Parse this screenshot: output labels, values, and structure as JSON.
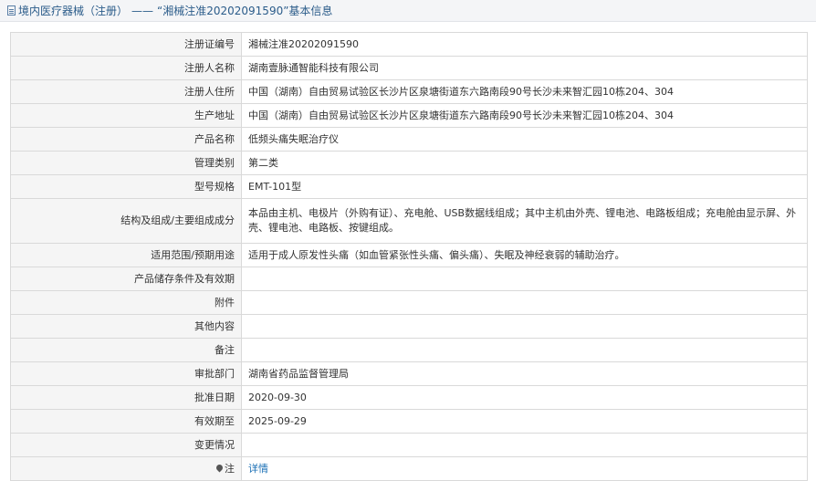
{
  "header": {
    "section": "境内医疗器械（注册）",
    "separator": "——",
    "title": "“湘械注准20202091590”基本信息"
  },
  "rows": [
    {
      "label": "注册证编号",
      "value": "湘械注准20202091590"
    },
    {
      "label": "注册人名称",
      "value": "湖南壹脉通智能科技有限公司"
    },
    {
      "label": "注册人住所",
      "value": "中国（湖南）自由贸易试验区长沙片区泉塘街道东六路南段90号长沙未来智汇园10栋204、304"
    },
    {
      "label": "生产地址",
      "value": "中国（湖南）自由贸易试验区长沙片区泉塘街道东六路南段90号长沙未来智汇园10栋204、304"
    },
    {
      "label": "产品名称",
      "value": "低频头痛失眠治疗仪"
    },
    {
      "label": "管理类别",
      "value": "第二类"
    },
    {
      "label": "型号规格",
      "value": "EMT-101型"
    },
    {
      "label": "结构及组成/主要组成成分",
      "value": "本品由主机、电极片（外购有证）、充电舱、USB数据线组成；其中主机由外壳、锂电池、电路板组成；充电舱由显示屏、外壳、锂电池、电路板、按键组成。"
    },
    {
      "label": "适用范围/预期用途",
      "value": "适用于成人原发性头痛（如血管紧张性头痛、偏头痛）、失眠及神经衰弱的辅助治疗。"
    },
    {
      "label": "产品储存条件及有效期",
      "value": ""
    },
    {
      "label": "附件",
      "value": ""
    },
    {
      "label": "其他内容",
      "value": ""
    },
    {
      "label": "备注",
      "value": ""
    },
    {
      "label": "审批部门",
      "value": "湖南省药品监督管理局"
    },
    {
      "label": "批准日期",
      "value": "2020-09-30"
    },
    {
      "label": "有效期至",
      "value": "2025-09-29"
    },
    {
      "label": "变更情况",
      "value": ""
    }
  ],
  "note_row": {
    "label": "注",
    "link_text": "详情"
  },
  "colors": {
    "link": "#1a6fb5",
    "label_bg": "#f5f5f5",
    "border": "#d9d9d9",
    "header_text": "#2b5c8a"
  }
}
